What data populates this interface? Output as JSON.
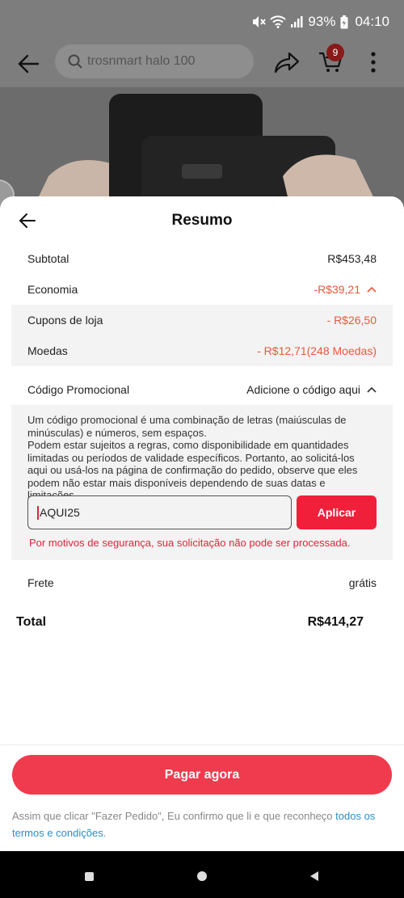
{
  "status_bar": {
    "battery": "93%",
    "time": "04:10"
  },
  "top_bar": {
    "search_text": "trosnmart halo 100",
    "cart_count": "9"
  },
  "sheet": {
    "title": "Resumo",
    "subtotal": {
      "label": "Subtotal",
      "value": "R$453,48"
    },
    "economia": {
      "label": "Economia",
      "value": "-R$39,21"
    },
    "cupons": {
      "label": "Cupons de loja",
      "value": "- R$26,50"
    },
    "moedas": {
      "label": "Moedas",
      "value": "- R$12,71(248 Moedas)"
    },
    "promo": {
      "label": "Código Promocional",
      "action": "Adicione o código aqui",
      "desc_line1": "Um código promocional é uma combinação de letras (maiúsculas de minúsculas) e números, sem espaços.",
      "desc_line2": "Podem estar sujeitos a regras, como disponibilidade em quantidades limitadas ou períodos de validade específicos. Portanto, ao solicitá-los aqui ou usá-los na página de confirmação do pedido, observe que eles podem não estar mais disponíveis dependendo de suas datas e limitações.",
      "input_value": "AQUI25",
      "apply_label": "Aplicar",
      "error": "Por motivos de segurança, sua solicitação não pode ser processada."
    },
    "frete": {
      "label": "Frete",
      "value": "grátis"
    },
    "total": {
      "label": "Total",
      "value": "R$414,27"
    },
    "pay_label": "Pagar agora",
    "legal_text": "Assim que clicar \"Fazer Pedido\", Eu confirmo que li e que reconheço ",
    "legal_link": "todos os termos e condições",
    "legal_end": "."
  },
  "colors": {
    "accent": "#f03a4d",
    "discount": "#e85a3c",
    "error": "#e0243a",
    "link": "#2a8fc9"
  }
}
